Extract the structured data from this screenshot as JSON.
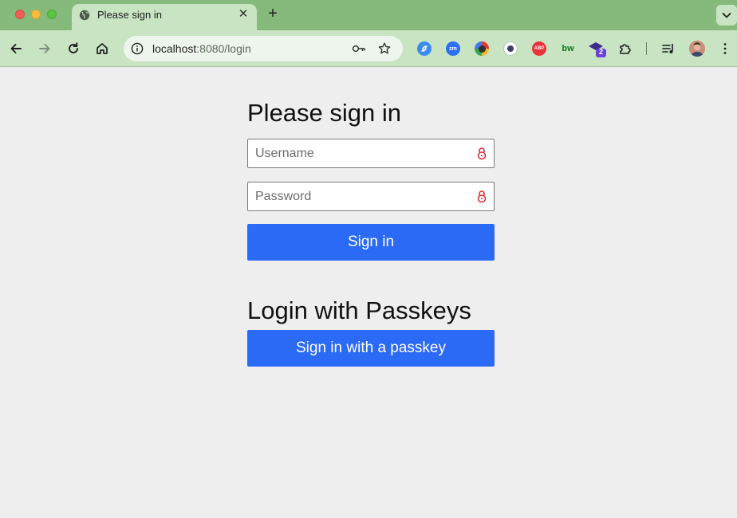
{
  "browser": {
    "tab": {
      "title": "Please sign in",
      "icon": "globe-icon",
      "close_glyph": "✕"
    },
    "new_tab_glyph": "+",
    "toolbar": {
      "url_host": "localhost",
      "url_rest": ":8080/login",
      "extensions": [
        {
          "name": "swirl-extension",
          "label": "",
          "color": "#3c8cf0"
        },
        {
          "name": "zoom-extension",
          "label": "zm",
          "color": "#2d6ff2"
        },
        {
          "name": "colorpicker-extension",
          "label": "",
          "color": "#303030"
        },
        {
          "name": "sheep-extension",
          "label": "",
          "color": "#ffffff"
        },
        {
          "name": "adblock-extension",
          "label": "ABP",
          "color": "#e8323c"
        },
        {
          "name": "bw-extension",
          "label": "bw",
          "color": "#0f7a1b"
        },
        {
          "name": "graduation-extension",
          "label": "2",
          "color": "#3e2a8c"
        }
      ]
    }
  },
  "login": {
    "title": "Please sign in",
    "username_placeholder": "Username",
    "password_placeholder": "Password",
    "signin_label": "Sign in",
    "passkey_title": "Login with Passkeys",
    "passkey_button_label": "Sign in with a passkey"
  },
  "colors": {
    "accent": "#2a6af4",
    "page_bg": "#eeeeee",
    "browser_frame": "#86ba7c",
    "toolbar_bg": "#c8e4c2",
    "lock_icon": "#d9232e"
  }
}
